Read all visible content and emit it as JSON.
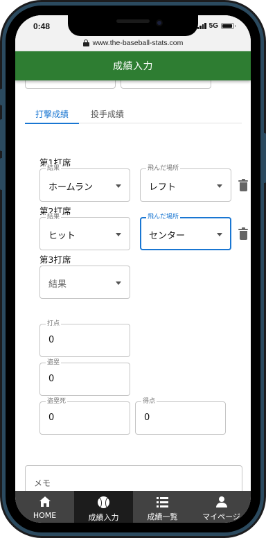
{
  "status_bar": {
    "time": "0:48",
    "network": "5G",
    "battery_level": 0.9
  },
  "browser": {
    "url": "www.the-baseball-stats.com"
  },
  "header": {
    "title": "成績入力"
  },
  "tabs": [
    {
      "label": "打撃成績",
      "active": true
    },
    {
      "label": "投手成績",
      "active": false
    }
  ],
  "at_bats": [
    {
      "label": "第1打席",
      "result_legend": "結果",
      "result": "ホームラン",
      "location_legend": "飛んだ場所",
      "location": "レフト"
    },
    {
      "label": "第2打席",
      "result_legend": "結果",
      "result": "ヒット",
      "location_legend": "飛んだ場所",
      "location": "センター"
    },
    {
      "label": "第3打席",
      "result_placeholder": "結果"
    }
  ],
  "stats": {
    "rbi": {
      "label": "打点",
      "value": "0"
    },
    "stolen_bases": {
      "label": "盗塁",
      "value": "0"
    },
    "caught_stealing": {
      "label": "盗塁死",
      "value": "0"
    },
    "runs": {
      "label": "得点",
      "value": "0"
    }
  },
  "memo": {
    "label": "メモ"
  },
  "bottom_nav": [
    {
      "label": "HOME",
      "icon": "home-icon",
      "active": false
    },
    {
      "label": "成績入力",
      "icon": "baseball-icon",
      "active": true
    },
    {
      "label": "成績一覧",
      "icon": "list-icon",
      "active": false
    },
    {
      "label": "マイページ",
      "icon": "person-icon",
      "active": false
    }
  ],
  "colors": {
    "header": "#2e7d32",
    "accent": "#1976d2",
    "nav_bg": "#424242",
    "nav_active": "#1c1c1c"
  }
}
